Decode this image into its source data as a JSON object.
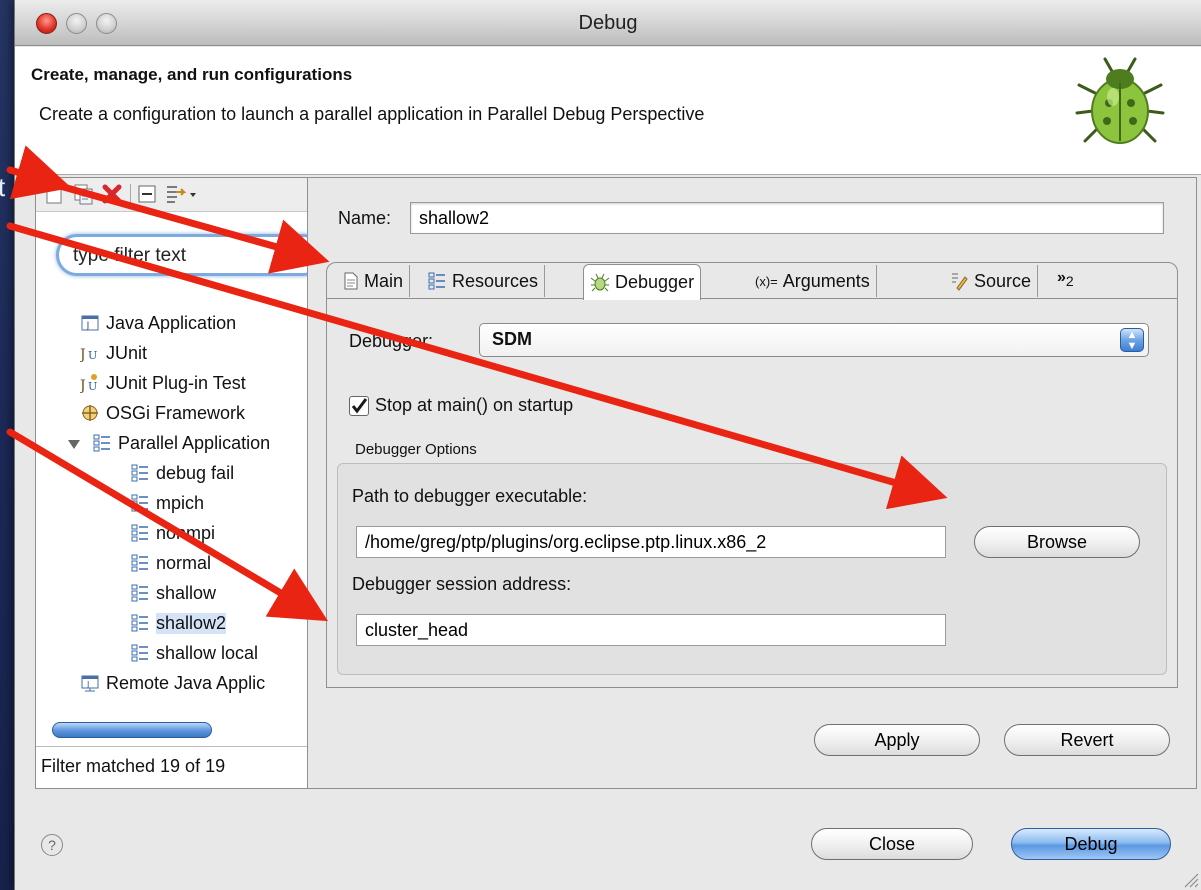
{
  "desktop": {
    "fragment_text": "t"
  },
  "window": {
    "title": "Debug"
  },
  "header": {
    "title": "Create, manage, and run configurations",
    "description": "Create a configuration to launch a parallel application in Parallel Debug Perspective",
    "icon": "ladybug-icon"
  },
  "left_panel": {
    "toolbar": [
      "new-config-icon",
      "duplicate-icon",
      "delete-icon",
      "collapse-all-icon",
      "filter-menu-icon"
    ],
    "filter_placeholder": "type filter text",
    "tree": [
      {
        "label": "Java Application",
        "icon": "java-app-icon",
        "level": 0
      },
      {
        "label": "JUnit",
        "icon": "junit-icon",
        "level": 0
      },
      {
        "label": "JUnit Plug-in Test",
        "icon": "junit-plugin-icon",
        "level": 0
      },
      {
        "label": "OSGi Framework",
        "icon": "osgi-icon",
        "level": 0
      },
      {
        "label": "Parallel Application",
        "icon": "parallel-app-icon",
        "level": 0,
        "expanded": true
      },
      {
        "label": "debug fail",
        "icon": "parallel-config-icon",
        "level": 1
      },
      {
        "label": "mpich",
        "icon": "parallel-config-icon",
        "level": 1
      },
      {
        "label": "nonmpi",
        "icon": "parallel-config-icon",
        "level": 1
      },
      {
        "label": "normal",
        "icon": "parallel-config-icon",
        "level": 1
      },
      {
        "label": "shallow",
        "icon": "parallel-config-icon",
        "level": 1
      },
      {
        "label": "shallow2",
        "icon": "parallel-config-icon",
        "level": 1,
        "selected": true
      },
      {
        "label": "shallow local",
        "icon": "parallel-config-icon",
        "level": 1
      },
      {
        "label": "Remote Java Applic",
        "icon": "remote-java-icon",
        "level": 0
      }
    ],
    "filter_status": "Filter matched 19 of 19"
  },
  "config": {
    "name_label": "Name:",
    "name_value": "shallow2",
    "tabs": [
      {
        "label": "Main",
        "icon": "main-tab-icon"
      },
      {
        "label": "Resources",
        "icon": "resources-tab-icon"
      },
      {
        "label": "Debugger",
        "icon": "debugger-tab-icon",
        "active": true
      },
      {
        "label": "Arguments",
        "icon": "arguments-tab-icon",
        "prefix": "(x)="
      },
      {
        "label": "Source",
        "icon": "source-tab-icon"
      }
    ],
    "tabs_overflow": "»",
    "tabs_overflow_count": "2",
    "debugger_label": "Debugger:",
    "debugger_value": "SDM",
    "stop_at_main_label": "Stop at main() on startup",
    "stop_at_main_checked": true,
    "options_title": "Debugger Options",
    "path_label": "Path to debugger executable:",
    "path_value": "/home/greg/ptp/plugins/org.eclipse.ptp.linux.x86_2",
    "browse_label": "Browse",
    "session_label": "Debugger session address:",
    "session_value": "cluster_head",
    "apply_label": "Apply",
    "revert_label": "Revert"
  },
  "footer": {
    "close_label": "Close",
    "debug_label": "Debug",
    "help_icon": "?"
  },
  "colors": {
    "arrow_red": "#ea2413",
    "desktop_blue": "#1f2d5c",
    "selection_blue": "#d5e3f7"
  }
}
